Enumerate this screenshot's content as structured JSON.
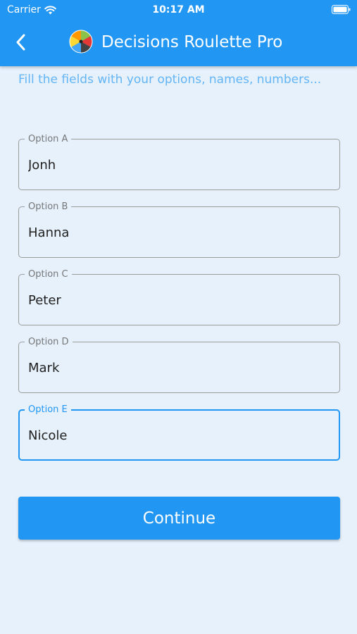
{
  "status_bar": {
    "carrier": "Carrier",
    "time": "10:17 AM",
    "icons": [
      "wifi-icon",
      "battery-icon"
    ]
  },
  "app_bar": {
    "title": "Decisions Roulette Pro",
    "back_icon": "chevron-left-icon",
    "logo_icon": "roulette-wheel-icon"
  },
  "instructions": "Fill the fields with your options, names, numbers...",
  "form": {
    "fields": [
      {
        "label": "Option A",
        "value": "Jonh"
      },
      {
        "label": "Option B",
        "value": "Hanna"
      },
      {
        "label": "Option C",
        "value": "Peter"
      },
      {
        "label": "Option D",
        "value": "Mark"
      },
      {
        "label": "Option E",
        "value": "Nicole",
        "focused": true
      }
    ]
  },
  "continue_label": "Continue",
  "colors": {
    "primary": "#2196f3",
    "background": "#e6f1fc",
    "hint_text": "#64b5f6",
    "field_border": "#9c9c9c"
  }
}
